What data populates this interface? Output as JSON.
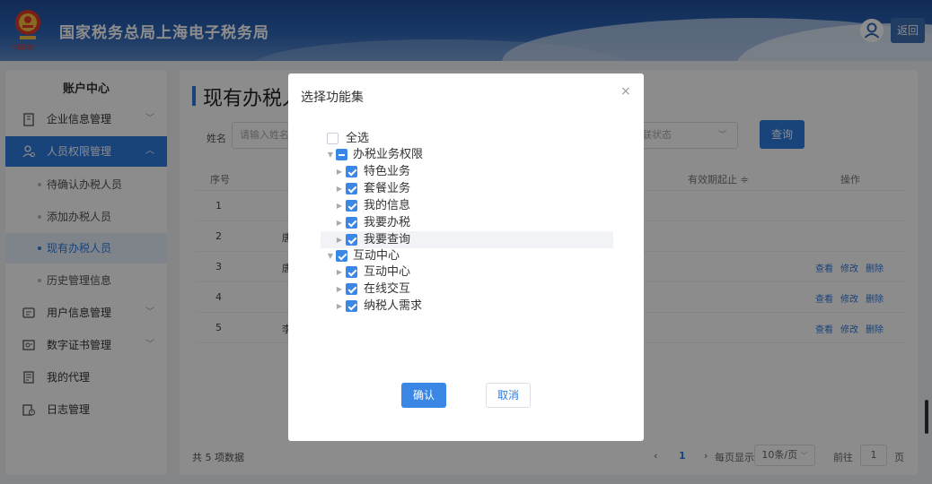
{
  "header": {
    "title": "国家税务总局上海电子税务局",
    "emblem_text": "中国税务",
    "back_label": "返回"
  },
  "sidebar": {
    "title": "账户中心",
    "items": [
      {
        "label": "企业信息管理",
        "icon": "building-icon"
      },
      {
        "label": "人员权限管理",
        "icon": "user-permission-icon"
      },
      {
        "label": "用户信息管理",
        "icon": "user-info-icon"
      },
      {
        "label": "数字证书管理",
        "icon": "certificate-icon"
      },
      {
        "label": "我的代理",
        "icon": "agency-icon"
      },
      {
        "label": "日志管理",
        "icon": "log-icon"
      }
    ],
    "subitems": [
      {
        "label": "待确认办税人员"
      },
      {
        "label": "添加办税人员"
      },
      {
        "label": "现有办税人员"
      },
      {
        "label": "历史管理信息"
      }
    ]
  },
  "main": {
    "page_title": "现有办税人",
    "filter": {
      "name_label": "姓名",
      "name_placeholder": "请输入姓名",
      "status_placeholder": "联状态",
      "query_label": "查询"
    },
    "table": {
      "headers": {
        "index": "序号",
        "expiry": "有效期起止 ≑",
        "ops": "操作"
      },
      "rows": [
        {
          "index": "1",
          "name": "",
          "ops": []
        },
        {
          "index": "2",
          "name": "唐",
          "ops": []
        },
        {
          "index": "3",
          "name": "唐",
          "ops": [
            "查看",
            "修改",
            "删除"
          ]
        },
        {
          "index": "4",
          "name": "",
          "ops": [
            "查看",
            "修改",
            "删除"
          ]
        },
        {
          "index": "5",
          "name": "李",
          "ops": [
            "查看",
            "修改",
            "删除"
          ]
        }
      ]
    },
    "footer": {
      "total": "共 5 项数据",
      "prev": "‹",
      "page": "1",
      "next": "›",
      "per_page_label": "每页显示",
      "per_page": "10条/页",
      "goto_label": "前往",
      "goto_page": "1",
      "goto_unit": "页"
    }
  },
  "modal": {
    "title": "选择功能集",
    "close": "×",
    "tree": [
      {
        "label": "全选",
        "state": "unchecked"
      },
      {
        "label": "办税业务权限",
        "state": "indeterminate"
      },
      {
        "label": "特色业务",
        "state": "checked"
      },
      {
        "label": "套餐业务",
        "state": "checked"
      },
      {
        "label": "我的信息",
        "state": "checked"
      },
      {
        "label": "我要办税",
        "state": "checked"
      },
      {
        "label": "我要查询",
        "state": "checked"
      },
      {
        "label": "互动中心",
        "state": "checked"
      },
      {
        "label": "互动中心",
        "state": "checked"
      },
      {
        "label": "在线交互",
        "state": "checked"
      },
      {
        "label": "纳税人需求",
        "state": "checked"
      }
    ],
    "confirm": "确认",
    "cancel": "取消"
  },
  "colors": {
    "primary": "#2d7ae0",
    "checkbox": "#3b87e6",
    "header": "#2d66b8"
  }
}
